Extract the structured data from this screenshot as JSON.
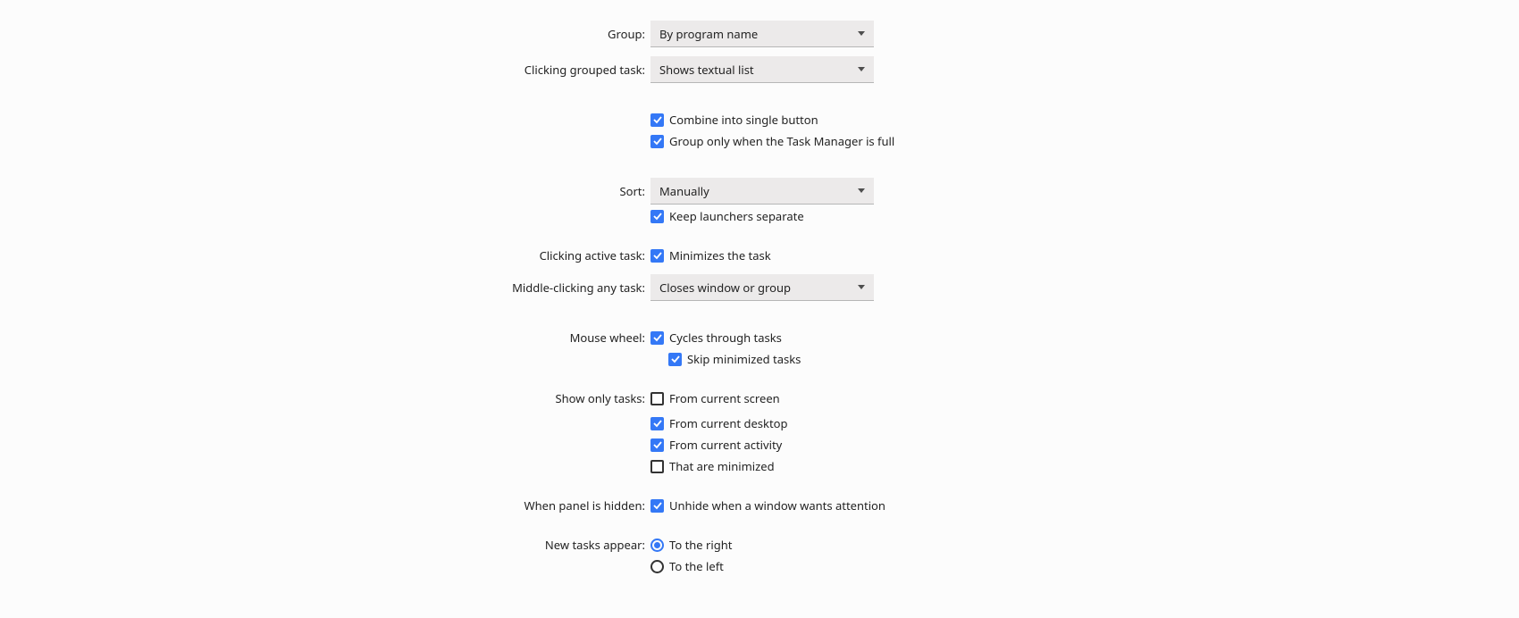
{
  "labels": {
    "group": "Group:",
    "clicking_grouped": "Clicking grouped task:",
    "sort": "Sort:",
    "clicking_active": "Clicking active task:",
    "middle_click": "Middle-clicking any task:",
    "mouse_wheel": "Mouse wheel:",
    "show_only": "Show only tasks:",
    "panel_hidden": "When panel is hidden:",
    "new_tasks": "New tasks appear:"
  },
  "selects": {
    "group": "By program name",
    "clicking_grouped": "Shows textual list",
    "sort": "Manually",
    "middle_click": "Closes window or group"
  },
  "checkboxes": {
    "combine": {
      "label": "Combine into single button",
      "checked": true
    },
    "group_full": {
      "label": "Group only when the Task Manager is full",
      "checked": true
    },
    "keep_launchers": {
      "label": "Keep launchers separate",
      "checked": true
    },
    "minimize_task": {
      "label": "Minimizes the task",
      "checked": true
    },
    "cycles": {
      "label": "Cycles through tasks",
      "checked": true
    },
    "skip_minimized": {
      "label": "Skip minimized tasks",
      "checked": true
    },
    "from_screen": {
      "label": "From current screen",
      "checked": false
    },
    "from_desktop": {
      "label": "From current desktop",
      "checked": true
    },
    "from_activity": {
      "label": "From current activity",
      "checked": true
    },
    "that_minimized": {
      "label": "That are minimized",
      "checked": false
    },
    "unhide": {
      "label": "Unhide when a window wants attention",
      "checked": true
    }
  },
  "radios": {
    "to_right": {
      "label": "To the right",
      "selected": true
    },
    "to_left": {
      "label": "To the left",
      "selected": false
    }
  }
}
